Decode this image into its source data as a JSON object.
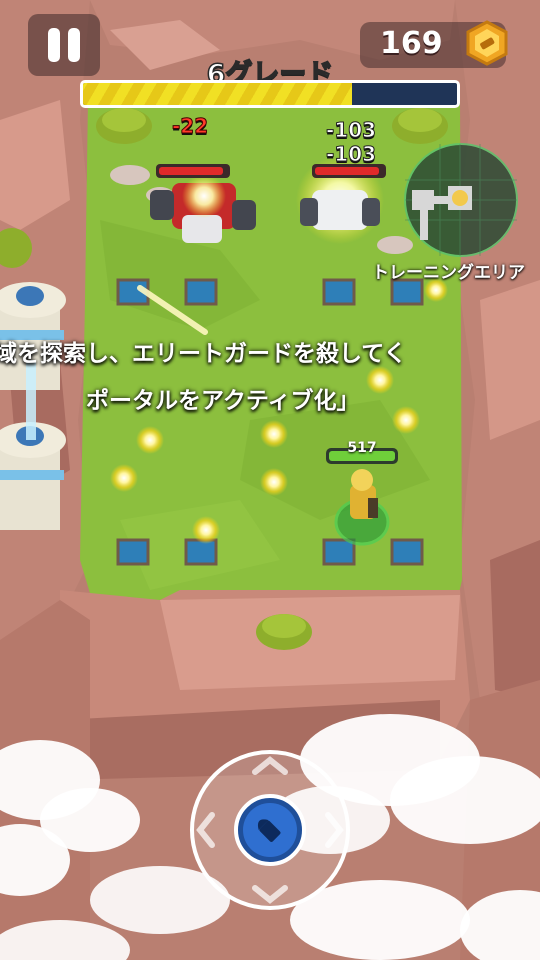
{
  "hud": {
    "coins": "169",
    "coin_icon": "gold-coin-icon",
    "pause_icon": "pause-icon",
    "grade_title": "6グレード",
    "grade_progress": 0.72
  },
  "combat_text": {
    "damage_1": "-22",
    "damage_2": "-103",
    "damage_3": "-103"
  },
  "minimap": {
    "label": "トレーニングエリア"
  },
  "mission": {
    "line1": "域を探索し、エリートガードを殺してく",
    "line2": "ポータルをアクティブ化」"
  },
  "player": {
    "hp": "517",
    "hp_fraction": 1.0
  },
  "enemies": [
    {
      "type": "red-robot",
      "hp_fraction": 0.9
    },
    {
      "type": "white-robot",
      "hp_fraction": 0.9
    }
  ],
  "controls": {
    "fire_icon": "bullet-icon"
  },
  "colors": {
    "grass": "#8cbf3e",
    "rock": "#c98a7d",
    "progress_fill": "#f1e024",
    "progress_track": "#1f3457",
    "enemy_hp": "#e02a2a",
    "player_hp": "#6fcf3a"
  }
}
